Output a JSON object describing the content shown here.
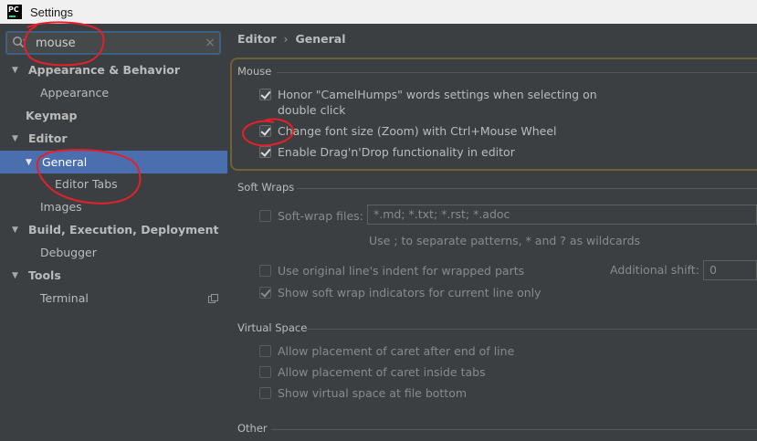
{
  "window": {
    "title": "Settings",
    "app_icon_text": "PC"
  },
  "search": {
    "value": "mouse",
    "clear_glyph": "×"
  },
  "tree": [
    {
      "label": "Appearance & Behavior",
      "expanded": true
    },
    {
      "label": "Appearance"
    },
    {
      "label": "Keymap"
    },
    {
      "label": "Editor",
      "expanded": true
    },
    {
      "label": "General",
      "selected": true,
      "expanded": true
    },
    {
      "label": "Editor Tabs"
    },
    {
      "label": "Images"
    },
    {
      "label": "Build, Execution, Deployment",
      "expanded": true
    },
    {
      "label": "Debugger"
    },
    {
      "label": "Tools",
      "expanded": true
    },
    {
      "label": "Terminal"
    }
  ],
  "breadcrumb": {
    "parent": "Editor",
    "separator": "›",
    "current": "General"
  },
  "sections": {
    "mouse": {
      "title": "Mouse",
      "options": [
        {
          "label_line1": "Honor \"CamelHumps\" words settings when selecting on",
          "label_line2": "double click",
          "checked": true
        },
        {
          "label": "Change font size (Zoom) with Ctrl+Mouse Wheel",
          "checked": true
        },
        {
          "label": "Enable Drag'n'Drop functionality in editor",
          "checked": true
        }
      ]
    },
    "soft_wraps": {
      "title": "Soft Wraps",
      "softwrap_files_label": "Soft-wrap files:",
      "softwrap_files_checked": false,
      "softwrap_files_value": "*.md; *.txt; *.rst; *.adoc",
      "hint": "Use ; to separate patterns, * and ? as wildcards",
      "original_indent_label": "Use original line's indent for wrapped parts",
      "original_indent_checked": false,
      "additional_shift_label": "Additional shift:",
      "additional_shift_value": "0",
      "show_indicators_label": "Show soft wrap indicators for current line only",
      "show_indicators_checked": true
    },
    "virtual_space": {
      "title": "Virtual Space",
      "options": [
        {
          "label": "Allow placement of caret after end of line",
          "checked": false
        },
        {
          "label": "Allow placement of caret inside tabs",
          "checked": false
        },
        {
          "label": "Show virtual space at file bottom",
          "checked": false
        }
      ]
    },
    "other": {
      "title": "Other"
    }
  },
  "colors": {
    "background": "#3c3f41",
    "selection": "#4b6eaf",
    "search_focus": "#3d6185",
    "highlight_border": "#6e6134",
    "annotation": "#e5202a"
  }
}
